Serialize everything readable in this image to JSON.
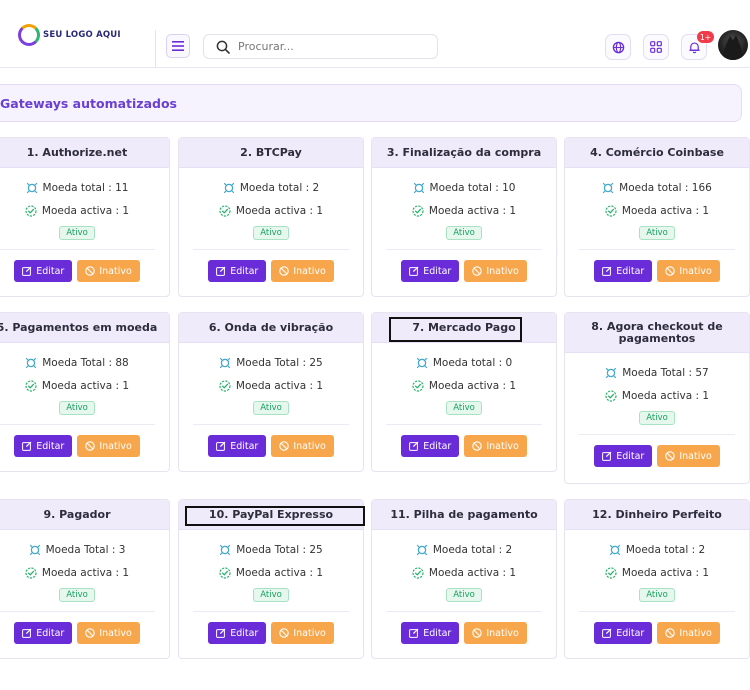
{
  "header": {
    "logo_text": "SEU LOGO AQUI",
    "search_placeholder": "Procurar...",
    "notification_badge": "1+"
  },
  "page": {
    "title": "Gateways automatizados"
  },
  "colors": {
    "accent": "#6a2bd9",
    "warning": "#f7a64c",
    "success": "#18a05c",
    "title": "#6a3fd2"
  },
  "labels": {
    "edit": "Editar",
    "inactive": "Inativo",
    "active_status": "Ativo"
  },
  "gateways": [
    {
      "title": "1. Authorize.net",
      "total": "Moeda total : 11",
      "active": "Moeda activa : 1"
    },
    {
      "title": "2. BTCPay",
      "total": "Moeda total : 2",
      "active": "Moeda activa : 1"
    },
    {
      "title": "3. Finalização da compra",
      "total": "Moeda total : 10",
      "active": "Moeda activa : 1"
    },
    {
      "title": "4. Comércio Coinbase",
      "total": "Moeda total : 166",
      "active": "Moeda activa : 1"
    },
    {
      "title": "5. Pagamentos em moeda",
      "total": "Moeda Total : 88",
      "active": "Moeda activa : 1"
    },
    {
      "title": "6. Onda de vibração",
      "total": "Moeda Total : 25",
      "active": "Moeda activa : 1"
    },
    {
      "title": "7. Mercado Pago",
      "total": "Moeda total : 0",
      "active": "Moeda activa : 1"
    },
    {
      "title": "8. Agora checkout de pagamentos",
      "total": "Moeda Total : 57",
      "active": "Moeda activa : 1"
    },
    {
      "title": "9. Pagador",
      "total": "Moeda Total : 3",
      "active": "Moeda activa : 1"
    },
    {
      "title": "10. PayPal Expresso",
      "total": "Moeda Total : 25",
      "active": "Moeda activa : 1"
    },
    {
      "title": "11. Pilha de pagamento",
      "total": "Moeda total : 2",
      "active": "Moeda activa : 1"
    },
    {
      "title": "12. Dinheiro Perfeito",
      "total": "Moeda total : 2",
      "active": "Moeda activa : 1"
    }
  ]
}
